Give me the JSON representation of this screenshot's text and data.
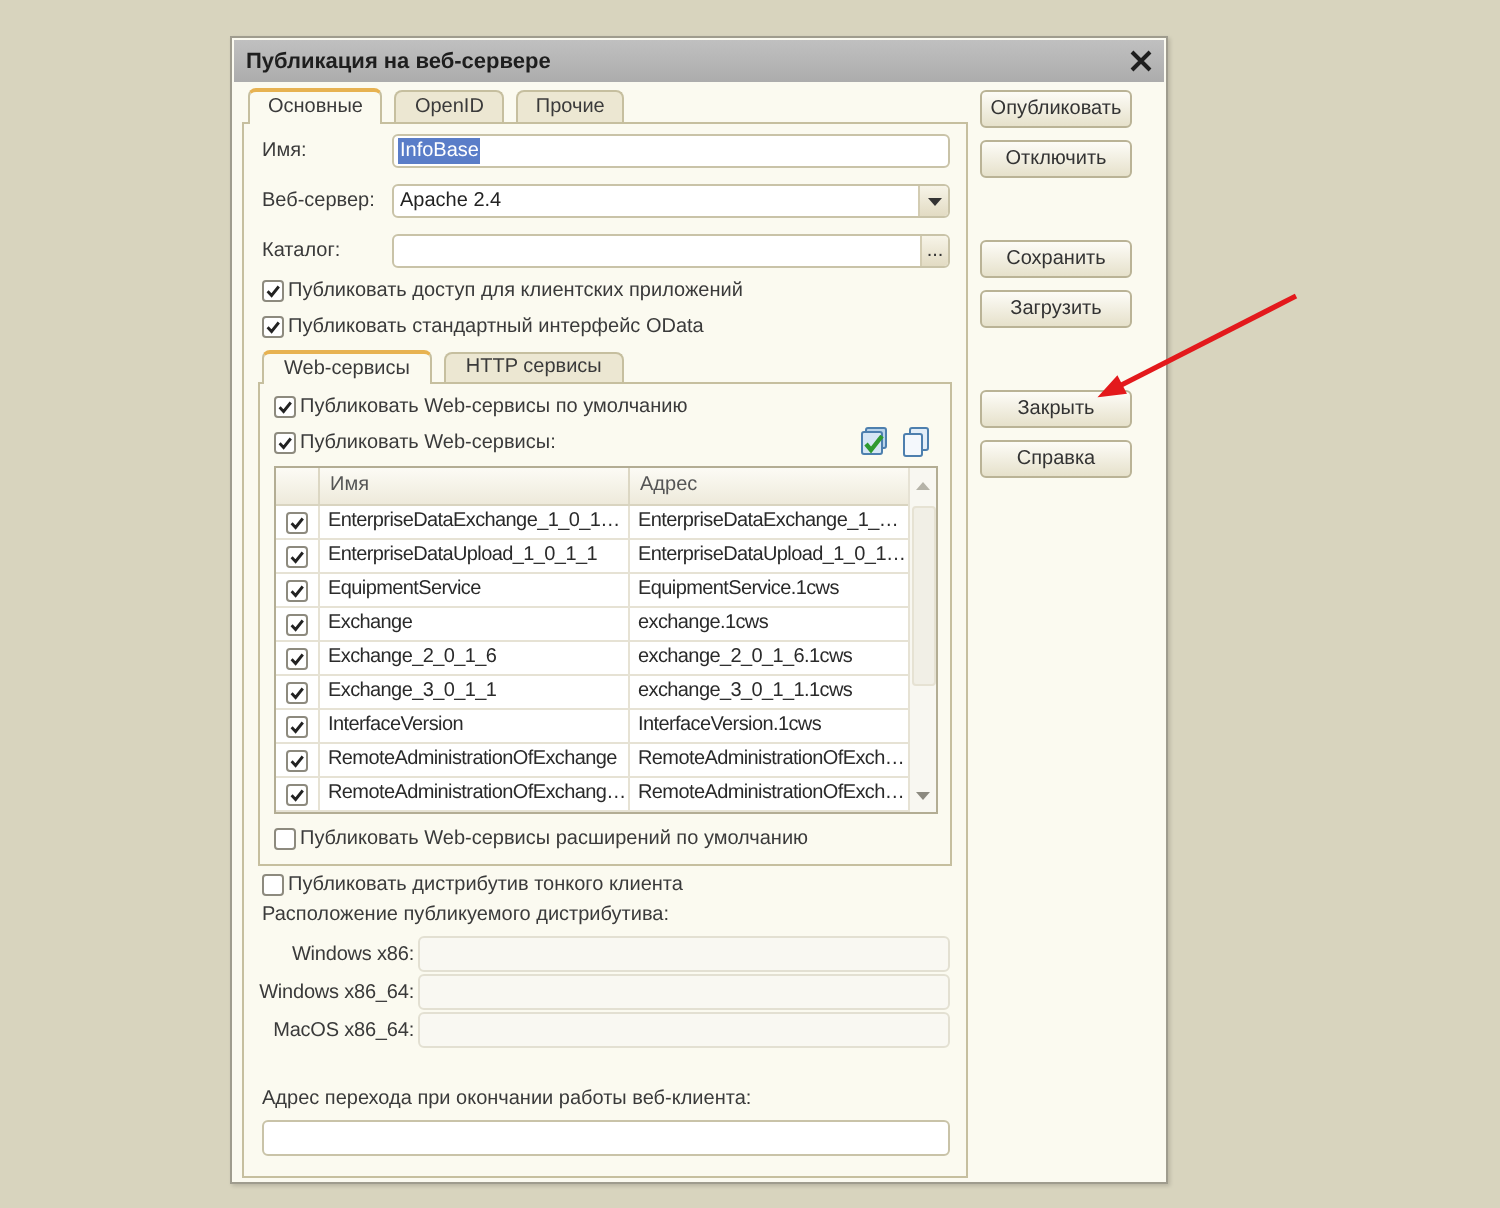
{
  "window": {
    "title": "Публикация на веб-сервере"
  },
  "tabs": [
    {
      "label": "Основные",
      "selected": true
    },
    {
      "label": "OpenID",
      "selected": false
    },
    {
      "label": "Прочие",
      "selected": false
    }
  ],
  "fields": [
    {
      "kind": "text",
      "label": "Имя:",
      "value": "InfoBase",
      "text_selected": true
    },
    {
      "kind": "combo",
      "label": "Веб-сервер:",
      "value": "Apache 2.4"
    },
    {
      "kind": "browse",
      "label": "Каталог:",
      "button": "..."
    }
  ],
  "options": [
    {
      "label": "Публиковать доступ для клиентских приложений",
      "checked": true
    },
    {
      "label": "Публиковать стандартный интерфейс OData",
      "checked": true
    }
  ],
  "inner_tabs": [
    {
      "label": "Web-сервисы",
      "selected": true
    },
    {
      "label": "HTTP сервисы",
      "selected": false
    }
  ],
  "web_services": {
    "options": [
      {
        "label": "Публиковать Web-сервисы по умолчанию",
        "checked": true
      },
      {
        "label": "Публиковать Web-сервисы:",
        "checked": true
      }
    ],
    "table": {
      "columns": [
        "Имя",
        "Адрес"
      ],
      "rows": [
        {
          "checked": true,
          "name": "EnterpriseDataExchange_1_0_1…",
          "address": "EnterpriseDataExchange_1_…"
        },
        {
          "checked": true,
          "name": "EnterpriseDataUpload_1_0_1_1",
          "address": "EnterpriseDataUpload_1_0_1…"
        },
        {
          "checked": true,
          "name": "EquipmentService",
          "address": "EquipmentService.1cws"
        },
        {
          "checked": true,
          "name": "Exchange",
          "address": "exchange.1cws"
        },
        {
          "checked": true,
          "name": "Exchange_2_0_1_6",
          "address": "exchange_2_0_1_6.1cws"
        },
        {
          "checked": true,
          "name": "Exchange_3_0_1_1",
          "address": "exchange_3_0_1_1.1cws"
        },
        {
          "checked": true,
          "name": "InterfaceVersion",
          "address": "InterfaceVersion.1cws"
        },
        {
          "checked": true,
          "name": "RemoteAdministrationOfExchange",
          "address": "RemoteAdministrationOfExch…"
        },
        {
          "checked": true,
          "name": "RemoteAdministrationOfExchang…",
          "address": "RemoteAdministrationOfExch…"
        }
      ]
    },
    "extensions_option": {
      "label": "Публиковать Web-сервисы расширений по умолчанию",
      "checked": false
    }
  },
  "thin_client": {
    "option": {
      "label": "Публиковать дистрибутив тонкого клиента",
      "checked": false
    },
    "location_label": "Расположение публикуемого дистрибутива:",
    "paths": [
      {
        "label": "Windows x86:",
        "disabled": true
      },
      {
        "label": "Windows x86_64:",
        "disabled": true
      },
      {
        "label": "MacOS x86_64:",
        "disabled": true
      }
    ]
  },
  "exit_address": {
    "label": "Адрес перехода при окончании работы веб-клиента:"
  },
  "button_groups": [
    [
      "Опубликовать",
      "Отключить"
    ],
    [
      "Сохранить",
      "Загрузить"
    ],
    [
      "Закрыть",
      "Справка"
    ]
  ],
  "annotation": {
    "kind": "arrow"
  }
}
